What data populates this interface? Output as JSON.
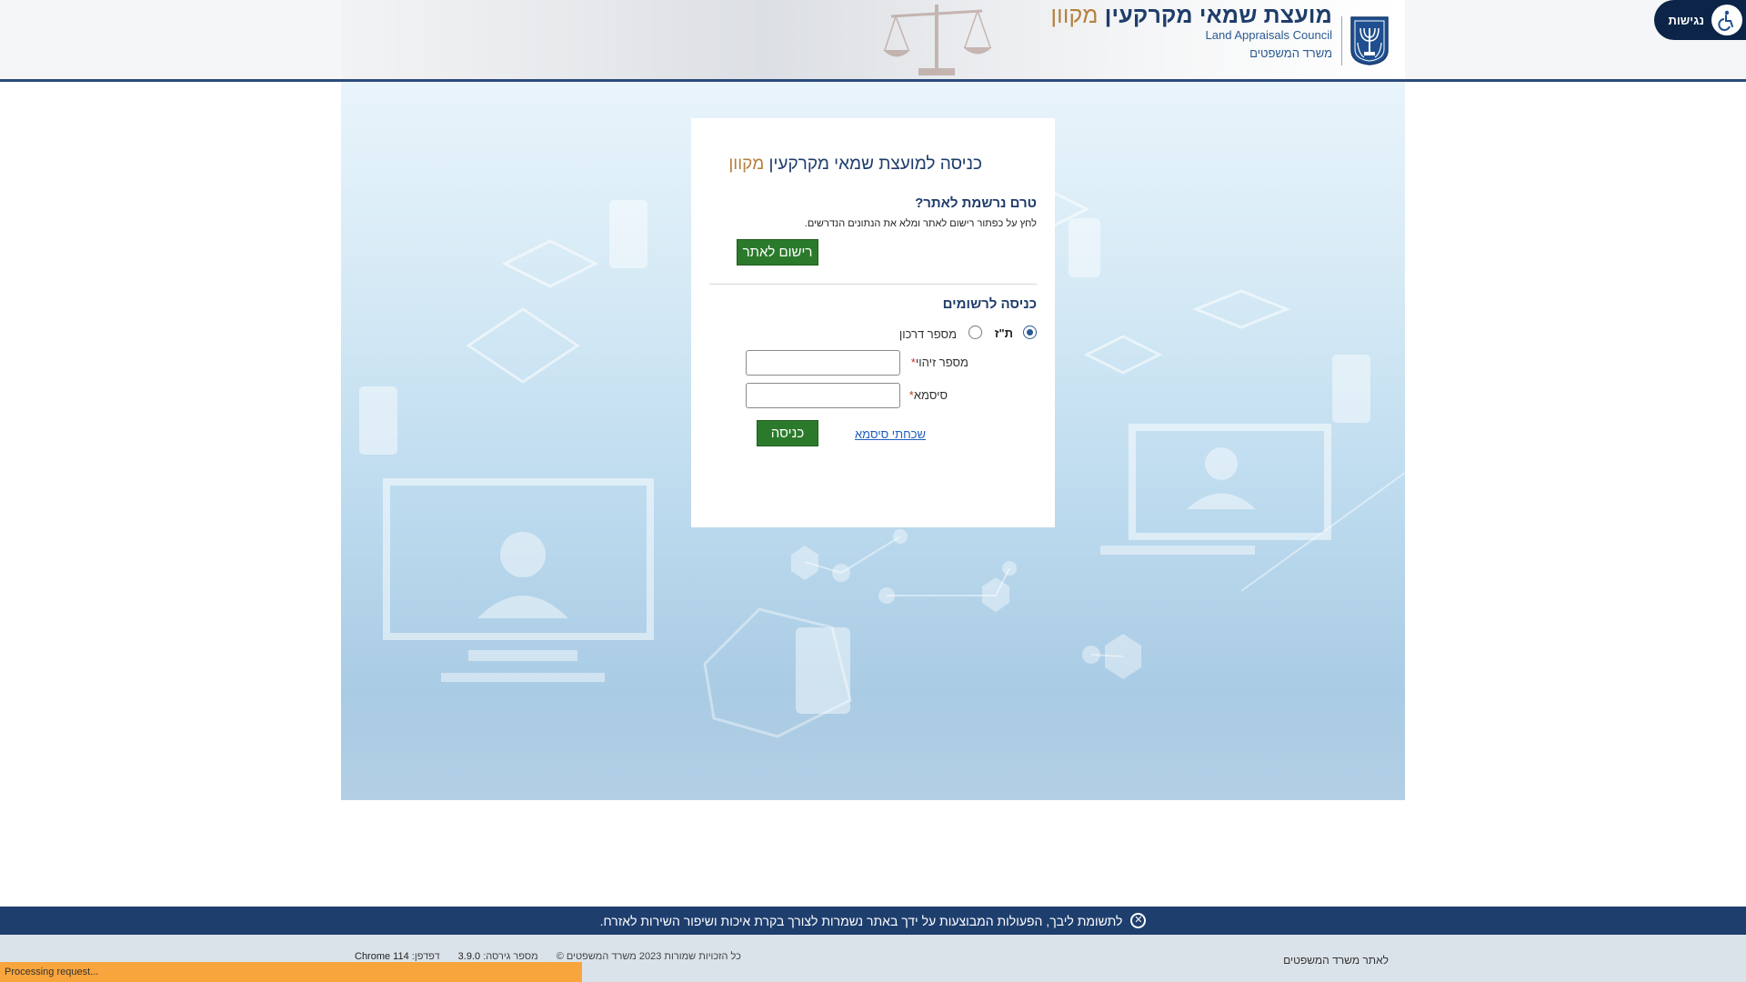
{
  "header": {
    "title_main": "מועצת שמאי מקרקעין",
    "title_online": "מקוון",
    "subtitle_en": "Land Appraisals Council",
    "ministry": "משרד המשפטים",
    "accessibility_label": "נגישות"
  },
  "card": {
    "title_main": "כניסה למועצת שמאי מקרקעין",
    "title_online": "מקוון",
    "register_heading": "טרם נרשמת לאתר?",
    "register_instructions": "לחץ על כפתור רישום לאתר ומלא את הנתונים הנדרשים.",
    "register_button": "רישום לאתר",
    "login_heading": "כניסה לרשומים",
    "radio_id_label": "ת\"ז",
    "radio_passport_label": "מספר דרכון",
    "selected_id_type": "ת\"ז",
    "id_field_label": "מספר זיהוי",
    "password_field_label": "סיסמא",
    "required_mark": "*",
    "id_value": "",
    "password_value": "",
    "forgot_password": "שכחתי סיסמא",
    "login_button": "כניסה"
  },
  "notice": {
    "text": "לתשומת ליבך, הפעולות המבוצעות על ידך באתר נשמרות לצורך בקרת איכות ושיפור השירות לאזרח.",
    "close_icon": "✕"
  },
  "footer": {
    "ministry_link": "לאתר משרד המשפטים",
    "copyright": "כל הזכויות שמורות 2023 משרד המשפטים ©",
    "version_label": "מספר גירסה:",
    "version_value": "3.9.0",
    "browser_label": "דפדפן:",
    "browser_value": "Chrome 114"
  },
  "status": {
    "processing": "Processing request..."
  },
  "colors": {
    "navy": "#1e3e6e",
    "title_blue": "#1f3d6b",
    "online_gold": "#b5813f",
    "button_green": "#2b7a2b",
    "status_orange": "#f9a53d"
  }
}
